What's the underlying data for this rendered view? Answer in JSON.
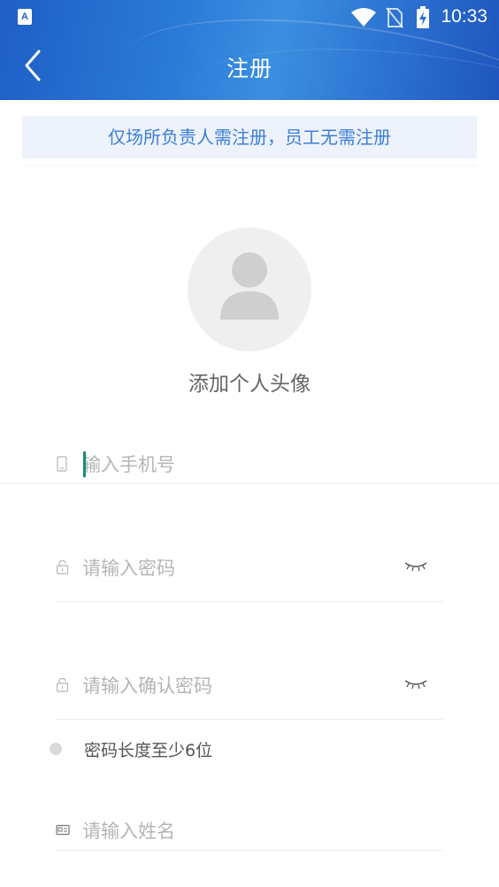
{
  "status_bar": {
    "app_icon_letter": "A",
    "time": "10:33"
  },
  "header": {
    "title": "注册"
  },
  "notice": {
    "text": "仅场所负责人需注册，员工无需注册"
  },
  "avatar": {
    "label": "添加个人头像"
  },
  "form": {
    "phone": {
      "placeholder": "输入手机号",
      "value": ""
    },
    "password": {
      "placeholder": "请输入密码",
      "value": ""
    },
    "confirm_password": {
      "placeholder": "请输入确认密码",
      "value": ""
    },
    "password_hint": "密码长度至少6位",
    "name": {
      "placeholder": "请输入姓名",
      "value": ""
    }
  },
  "colors": {
    "header_blue": "#2a7ad6",
    "notice_text": "#3d7fd6",
    "notice_bg": "#edf2fb",
    "caret": "#1a8a78"
  }
}
